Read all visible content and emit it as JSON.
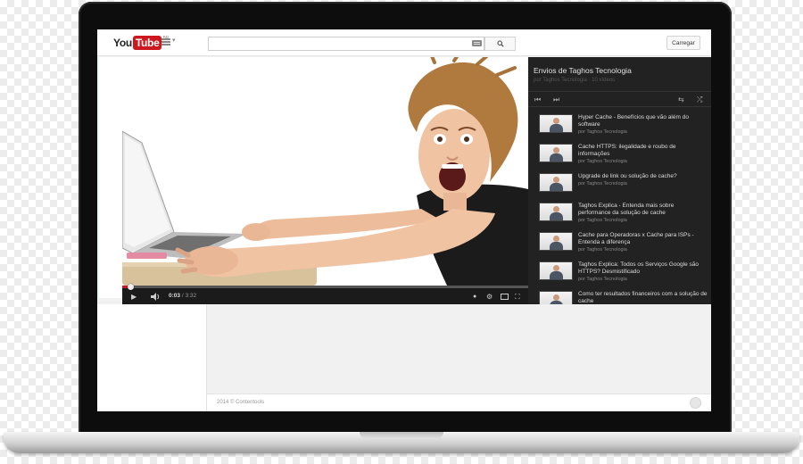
{
  "header": {
    "logo_you": "You",
    "logo_tube": "Tube",
    "logo_suffix": "BR",
    "search_placeholder": "",
    "search_value": "",
    "upload_label": "Carregar"
  },
  "player": {
    "current_time": "0:03",
    "separator": " / ",
    "duration": "3:32",
    "progress": 0.014
  },
  "playlist": {
    "title": "Envios de Taghos Tecnologia",
    "subtitle": "por Taghos Tecnologia · 10 vídeos",
    "items": [
      {
        "title": "Hyper Cache - Benefícios que vão além do software",
        "author": "por Taghos Tecnologia"
      },
      {
        "title": "Cache HTTPS: ilegalidade e roubo de informações",
        "author": "por Taghos Tecnologia"
      },
      {
        "title": "Upgrade de link ou solução de cache?",
        "author": "por Taghos Tecnologia"
      },
      {
        "title": "Taghos Explica - Entenda mais sobre performance da solução de cache",
        "author": "por Taghos Tecnologia"
      },
      {
        "title": "Cache para Operadoras x Cache para ISPs - Entenda a diferença",
        "author": "por Taghos Tecnologia"
      },
      {
        "title": "Taghos Explica: Todos os Serviços Google são HTTPS? Desmistificado",
        "author": "por Taghos Tecnologia"
      },
      {
        "title": "Como ter resultados financeiros com a solução de cache",
        "author": ""
      }
    ]
  },
  "footer": {
    "text": "2014 © Contentools"
  },
  "colors": {
    "brand_red": "#cc181e",
    "playlist_bg": "#222222"
  }
}
